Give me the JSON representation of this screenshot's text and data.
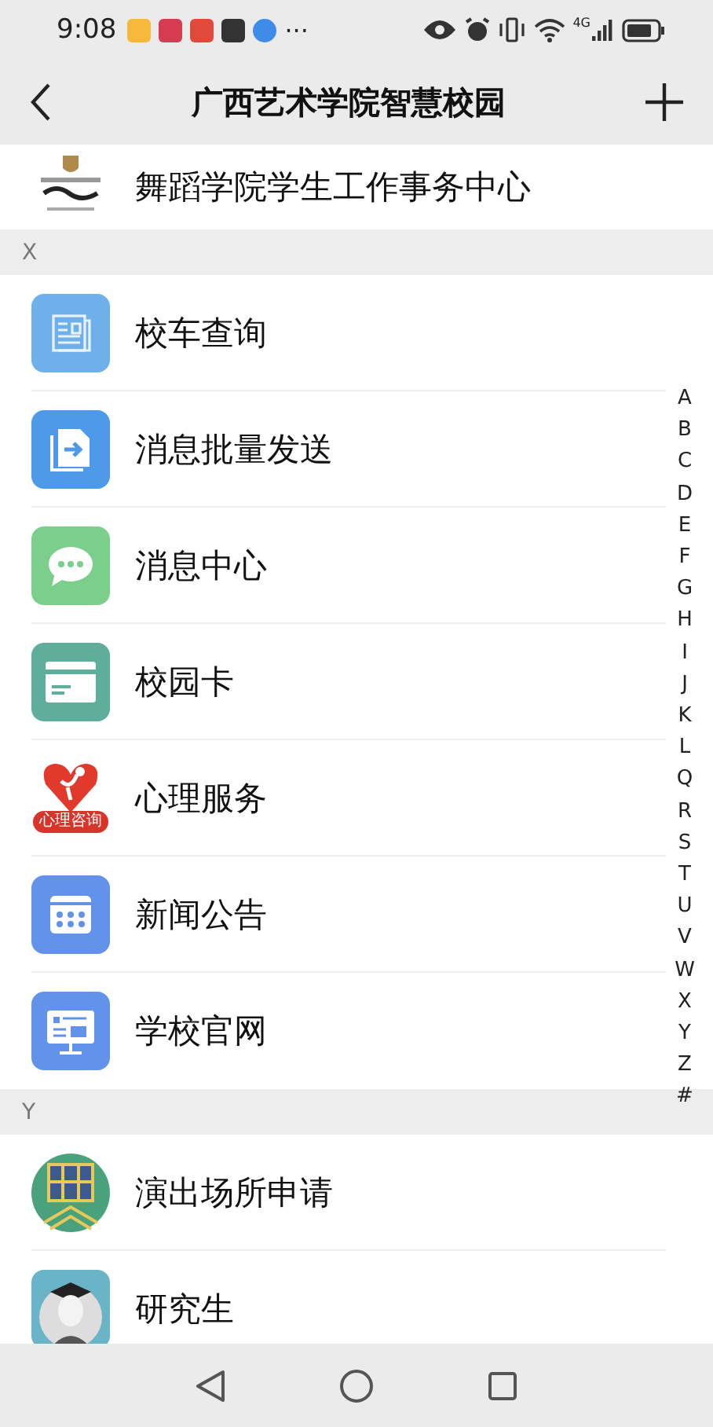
{
  "status_bar": {
    "time": "9:08",
    "more": "···",
    "network": "4G"
  },
  "header": {
    "title": "广西艺术学院智慧校园"
  },
  "sections": [
    {
      "items": [
        {
          "label": "舞蹈学院学生工作事务中心",
          "kind": "logo"
        }
      ]
    },
    {
      "letter": "X",
      "items": [
        {
          "label": "校车查询",
          "kind": "document"
        },
        {
          "label": "消息批量发送",
          "kind": "forward"
        },
        {
          "label": "消息中心",
          "kind": "chat"
        },
        {
          "label": "校园卡",
          "kind": "card"
        },
        {
          "label": "心理服务",
          "kind": "heart",
          "badge": "心理咨询"
        },
        {
          "label": "新闻公告",
          "kind": "calendar"
        },
        {
          "label": "学校官网",
          "kind": "monitor"
        }
      ]
    },
    {
      "letter": "Y",
      "items": [
        {
          "label": "演出场所申请",
          "kind": "building"
        },
        {
          "label": "研究生",
          "kind": "graduate"
        }
      ]
    }
  ],
  "index": [
    "A",
    "B",
    "C",
    "D",
    "E",
    "F",
    "G",
    "H",
    "I",
    "J",
    "K",
    "L",
    "Q",
    "R",
    "S",
    "T",
    "U",
    "V",
    "W",
    "X",
    "Y",
    "Z",
    "#"
  ]
}
